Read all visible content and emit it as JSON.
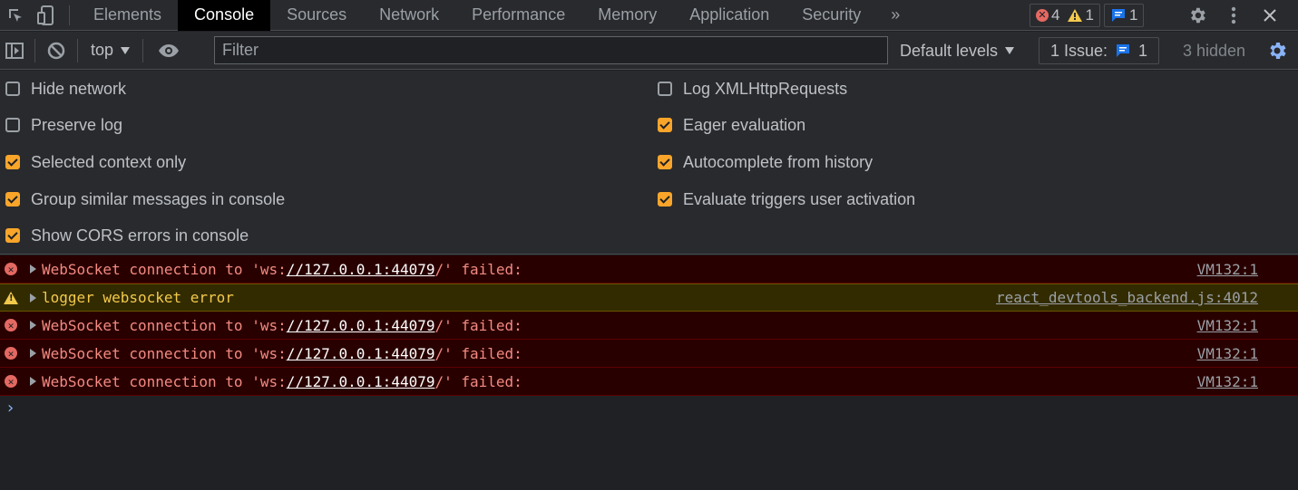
{
  "tabbar": {
    "tabs": [
      {
        "label": "Elements"
      },
      {
        "label": "Console",
        "active": true
      },
      {
        "label": "Sources"
      },
      {
        "label": "Network"
      },
      {
        "label": "Performance"
      },
      {
        "label": "Memory"
      },
      {
        "label": "Application"
      },
      {
        "label": "Security"
      }
    ],
    "more_label": "»",
    "counters": {
      "errors": "4",
      "warnings": "1",
      "messages": "1"
    }
  },
  "toolbar": {
    "context": "top",
    "filter_placeholder": "Filter",
    "levels": "Default levels",
    "issues_label": "1 Issue:",
    "issues_count": "1",
    "hidden": "3 hidden"
  },
  "settings": {
    "left": [
      {
        "label": "Hide network",
        "checked": false
      },
      {
        "label": "Preserve log",
        "checked": false
      },
      {
        "label": "Selected context only",
        "checked": true
      },
      {
        "label": "Group similar messages in console",
        "checked": true
      },
      {
        "label": "Show CORS errors in console",
        "checked": true
      }
    ],
    "right": [
      {
        "label": "Log XMLHttpRequests",
        "checked": false
      },
      {
        "label": "Eager evaluation",
        "checked": true
      },
      {
        "label": "Autocomplete from history",
        "checked": true
      },
      {
        "label": "Evaluate triggers user activation",
        "checked": true
      }
    ]
  },
  "messages": [
    {
      "level": "error",
      "pre": "WebSocket connection to 'ws:",
      "url": "//127.0.0.1:44079",
      "post": "/' failed:",
      "source": "VM132:1"
    },
    {
      "level": "warning",
      "pre": "logger websocket error",
      "url": "",
      "post": "",
      "source": "react_devtools_backend.js:4012"
    },
    {
      "level": "error",
      "pre": "WebSocket connection to 'ws:",
      "url": "//127.0.0.1:44079",
      "post": "/' failed:",
      "source": "VM132:1"
    },
    {
      "level": "error",
      "pre": "WebSocket connection to 'ws:",
      "url": "//127.0.0.1:44079",
      "post": "/' failed:",
      "source": "VM132:1"
    },
    {
      "level": "error",
      "pre": "WebSocket connection to 'ws:",
      "url": "//127.0.0.1:44079",
      "post": "/' failed:",
      "source": "VM132:1"
    }
  ],
  "prompt": "›",
  "colors": {
    "accent": "#f8a52a",
    "error": "#f28b82",
    "warning": "#f2c94c",
    "link_blue": "#8ab4f8"
  }
}
